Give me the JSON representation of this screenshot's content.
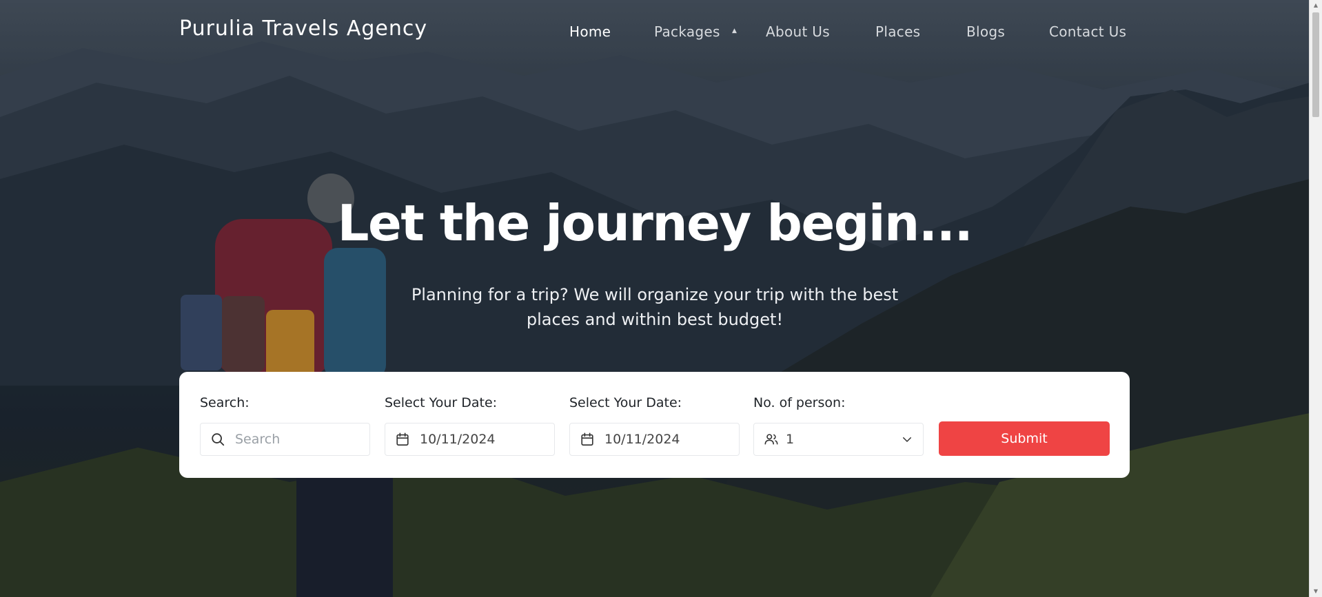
{
  "brand": {
    "name": "Purulia Travels Agency"
  },
  "nav": {
    "items": [
      {
        "label": "Home",
        "active": true
      },
      {
        "label": "Packages",
        "active": false,
        "has_dropdown": true
      },
      {
        "label": "About Us",
        "active": false
      },
      {
        "label": "Places",
        "active": false
      },
      {
        "label": "Blogs",
        "active": false
      },
      {
        "label": "Contact Us",
        "active": false
      }
    ]
  },
  "hero": {
    "headline": "Let the journey begin...",
    "subtitle_line1": "Planning for a trip? We will organize your trip with the best",
    "subtitle_line2": "places and within best budget!"
  },
  "booking": {
    "search": {
      "label": "Search:",
      "placeholder": "Search",
      "icon": "search-icon"
    },
    "date_from": {
      "label": "Select Your Date:",
      "value": "10/11/2024",
      "icon": "calendar-icon"
    },
    "date_to": {
      "label": "Select Your Date:",
      "value": "10/11/2024",
      "icon": "calendar-icon"
    },
    "persons": {
      "label": "No. of person:",
      "value": "1",
      "icon": "users-icon"
    },
    "submit_label": "Submit"
  },
  "colors": {
    "accent": "#ef4444",
    "card_bg": "#ffffff",
    "text_dark": "#1f2328"
  }
}
